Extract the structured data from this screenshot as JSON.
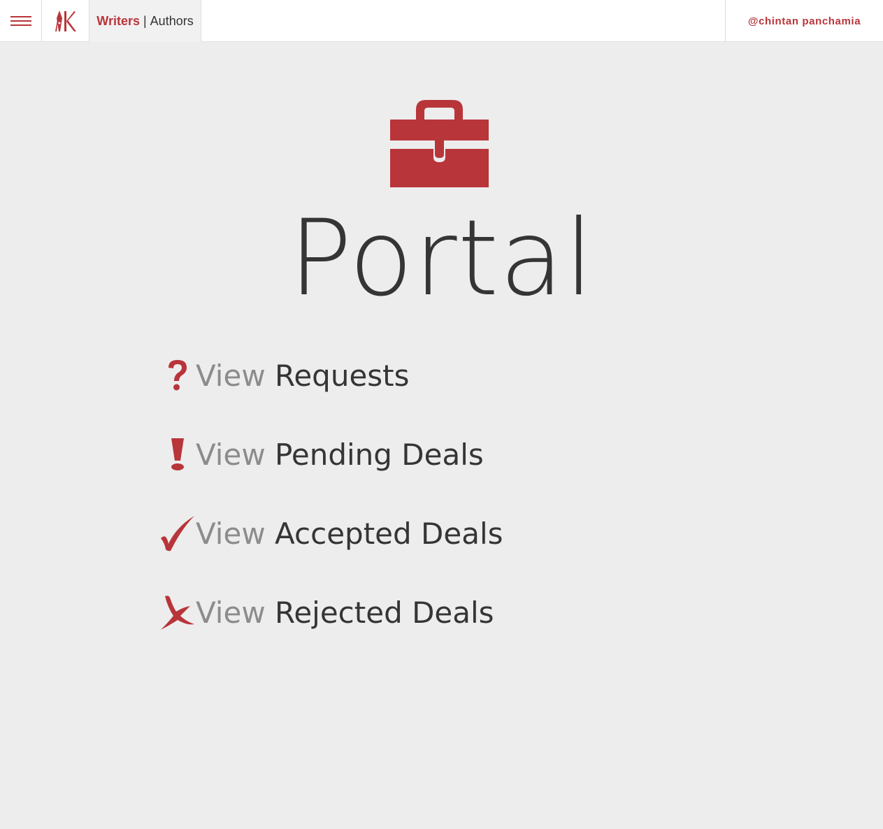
{
  "header": {
    "brand_primary": "Writers",
    "brand_separator": "|",
    "brand_secondary": "Authors",
    "user_handle": "@chintan panchamia"
  },
  "main": {
    "title": "Portal",
    "icon": "briefcase-icon",
    "menu": [
      {
        "icon": "question-icon",
        "verb": "View",
        "label": "Requests"
      },
      {
        "icon": "exclamation-icon",
        "verb": "View",
        "label": "Pending Deals"
      },
      {
        "icon": "check-icon",
        "verb": "View",
        "label": "Accepted Deals"
      },
      {
        "icon": "x-icon",
        "verb": "View",
        "label": "Rejected Deals"
      }
    ]
  },
  "colors": {
    "accent": "#b8353a",
    "background": "#ededed",
    "text_dark": "#353535",
    "text_muted": "#8c8c8c"
  }
}
